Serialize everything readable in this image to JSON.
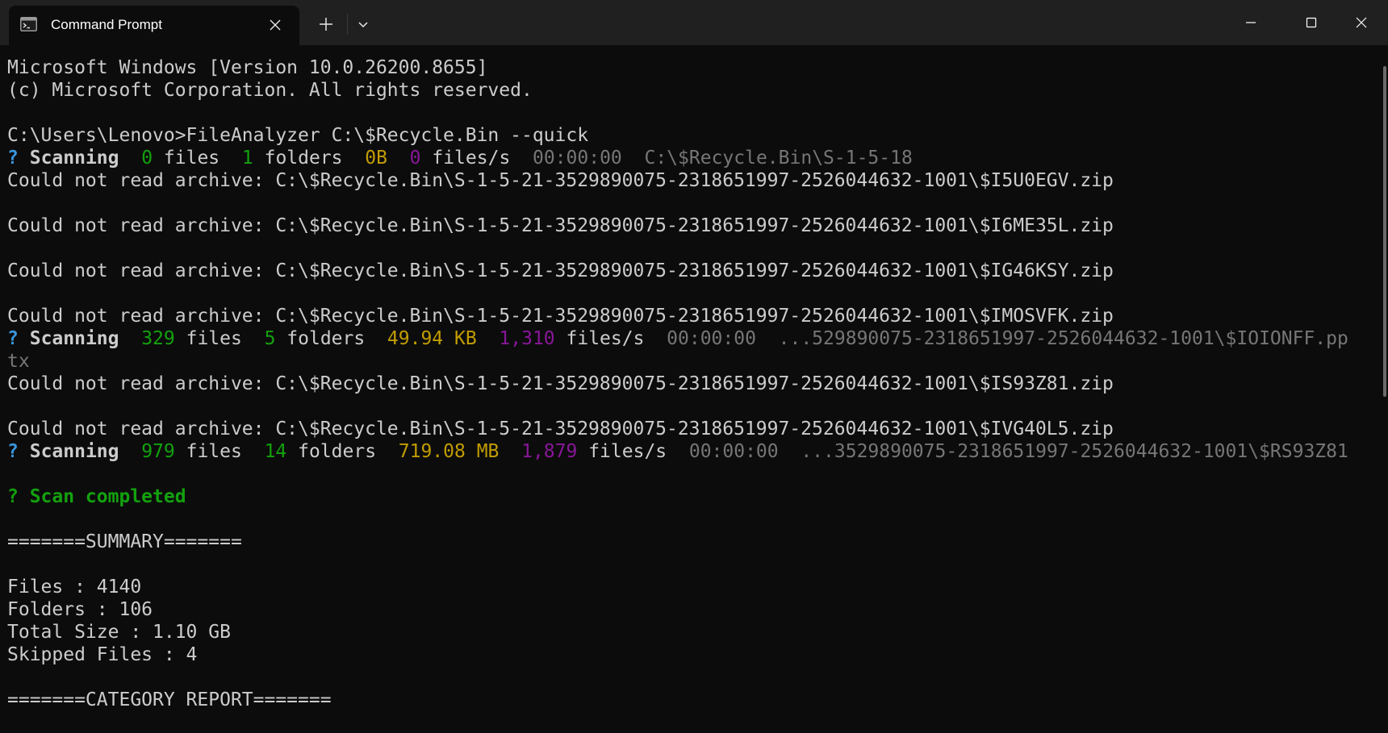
{
  "window": {
    "tab_title": "Command Prompt",
    "icons": {
      "tab": "terminal-icon",
      "close_tab": "close-icon",
      "new_tab": "plus-icon",
      "dropdown": "chevron-down-icon",
      "minimize": "minimize-icon",
      "maximize": "maximize-icon",
      "close_window": "close-icon"
    }
  },
  "colors": {
    "background": "#0c0c0c",
    "titlebar": "#202020",
    "text": "#cccccc",
    "blue": "#3a96dd",
    "green": "#13a10e",
    "yellow": "#c19c00",
    "magenta": "#881798",
    "dim": "#767676"
  },
  "terminal": {
    "lines": [
      {
        "kind": "plain",
        "text": "Microsoft Windows [Version 10.0.26200.8655]"
      },
      {
        "kind": "plain",
        "text": "(c) Microsoft Corporation. All rights reserved."
      },
      {
        "kind": "blank",
        "text": ""
      },
      {
        "kind": "prompt",
        "text": "C:\\Users\\Lenovo>FileAnalyzer C:\\$Recycle.Bin --quick"
      },
      {
        "kind": "scan",
        "marker": "?",
        "label": "Scanning",
        "files": "0",
        "files_label": "files",
        "folders": "1",
        "folders_label": "folders",
        "size": "0B",
        "rate": "0",
        "rate_label": "files/s",
        "time": "00:00:00",
        "path": "C:\\$Recycle.Bin\\S-1-5-18"
      },
      {
        "kind": "plain",
        "text": "Could not read archive: C:\\$Recycle.Bin\\S-1-5-21-3529890075-2318651997-2526044632-1001\\$I5U0EGV.zip"
      },
      {
        "kind": "blank",
        "text": ""
      },
      {
        "kind": "plain",
        "text": "Could not read archive: C:\\$Recycle.Bin\\S-1-5-21-3529890075-2318651997-2526044632-1001\\$I6ME35L.zip"
      },
      {
        "kind": "blank",
        "text": ""
      },
      {
        "kind": "plain",
        "text": "Could not read archive: C:\\$Recycle.Bin\\S-1-5-21-3529890075-2318651997-2526044632-1001\\$IG46KSY.zip"
      },
      {
        "kind": "blank",
        "text": ""
      },
      {
        "kind": "plain",
        "text": "Could not read archive: C:\\$Recycle.Bin\\S-1-5-21-3529890075-2318651997-2526044632-1001\\$IMOSVFK.zip"
      },
      {
        "kind": "scan",
        "marker": "?",
        "label": "Scanning",
        "files": "329",
        "files_label": "files",
        "folders": "5",
        "folders_label": "folders",
        "size": "49.94 KB",
        "rate": "1,310",
        "rate_label": "files/s",
        "time": "00:00:00",
        "path": "...529890075-2318651997-2526044632-1001\\$IOIONFF.pp"
      },
      {
        "kind": "dim",
        "text": "tx"
      },
      {
        "kind": "plain",
        "text": "Could not read archive: C:\\$Recycle.Bin\\S-1-5-21-3529890075-2318651997-2526044632-1001\\$IS93Z81.zip"
      },
      {
        "kind": "blank",
        "text": ""
      },
      {
        "kind": "plain",
        "text": "Could not read archive: C:\\$Recycle.Bin\\S-1-5-21-3529890075-2318651997-2526044632-1001\\$IVG40L5.zip"
      },
      {
        "kind": "scan",
        "marker": "?",
        "label": "Scanning",
        "files": "979",
        "files_label": "files",
        "folders": "14",
        "folders_label": "folders",
        "size": "719.08 MB",
        "rate": "1,879",
        "rate_label": "files/s",
        "time": "00:00:00",
        "path": "...3529890075-2318651997-2526044632-1001\\$RS93Z81"
      },
      {
        "kind": "blank",
        "text": ""
      },
      {
        "kind": "success",
        "text": "? Scan completed"
      },
      {
        "kind": "blank",
        "text": ""
      },
      {
        "kind": "plain",
        "text": "=======SUMMARY======="
      },
      {
        "kind": "blank",
        "text": ""
      },
      {
        "kind": "plain",
        "text": "Files : 4140"
      },
      {
        "kind": "plain",
        "text": "Folders : 106"
      },
      {
        "kind": "plain",
        "text": "Total Size : 1.10 GB"
      },
      {
        "kind": "plain",
        "text": "Skipped Files : 4"
      },
      {
        "kind": "blank",
        "text": ""
      },
      {
        "kind": "plain",
        "text": "=======CATEGORY REPORT======="
      }
    ]
  }
}
